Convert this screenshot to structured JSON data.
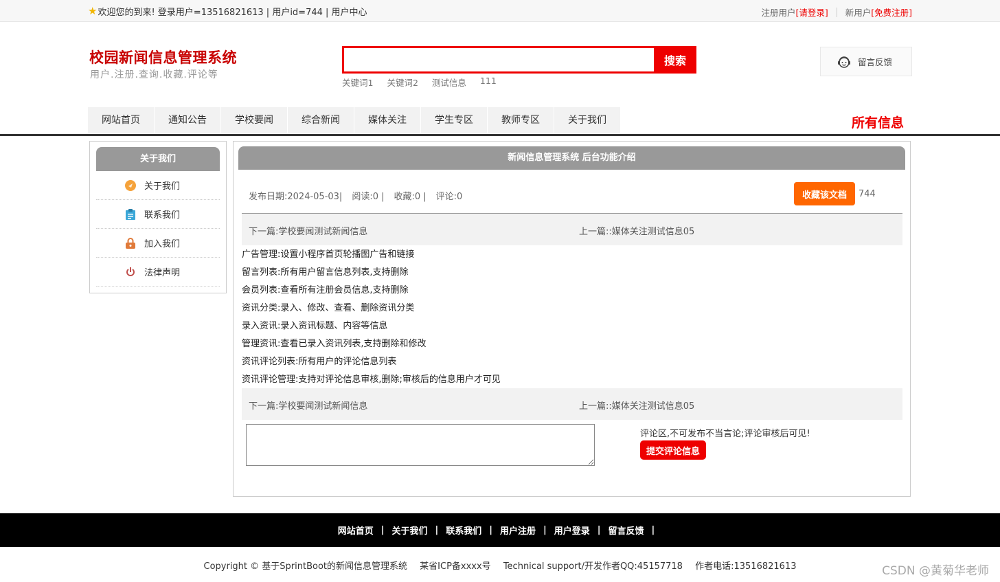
{
  "topbar": {
    "welcome": "欢迎您的到来!  登录用户=13516821613 | 用户id=744 | 用户中心",
    "reg_label": "注册用户",
    "login_link": "[请登录]",
    "new_label": "新用户",
    "register_link": "[免费注册]"
  },
  "header": {
    "title": "校园新闻信息管理系统",
    "subtitle": "用户.注册.查询.收藏.评论等",
    "search_button": "搜索",
    "keywords": [
      "关键词1",
      "关键词2",
      "测试信息",
      "111"
    ],
    "feedback": "留言反馈"
  },
  "nav": {
    "items": [
      "网站首页",
      "通知公告",
      "学校要闻",
      "综合新闻",
      "媒体关注",
      "学生专区",
      "教师专区",
      "关于我们"
    ],
    "all_info": "所有信息"
  },
  "sidebar": {
    "title": "关于我们",
    "items": [
      {
        "label": "关于我们",
        "icon": "orange-circle-icon"
      },
      {
        "label": "联系我们",
        "icon": "clipboard-icon"
      },
      {
        "label": "加入我们",
        "icon": "lock-icon"
      },
      {
        "label": "法律声明",
        "icon": "power-icon"
      }
    ]
  },
  "article": {
    "title": "新闻信息管理系统 后台功能介绍",
    "date": "发布日期:2024-05-03|",
    "reads": "阅读:0 |",
    "favorites": "收藏:0 |",
    "comments": "评论:0",
    "fav_button": "收藏该文档",
    "fav_count": "744",
    "next": "下一篇:学校要闻测试新闻信息",
    "prev": "上一篇::媒体关注测试信息05",
    "lines": [
      "广告管理:设置小程序首页轮播图广告和链接",
      "留言列表:所有用户留言信息列表,支持删除",
      "会员列表:查看所有注册会员信息,支持删除",
      "资讯分类:录入、修改、查看、删除资讯分类",
      "录入资讯:录入资讯标题、内容等信息",
      "管理资讯:查看已录入资讯列表,支持删除和修改",
      "资讯评论列表:所有用户的评论信息列表",
      "资讯评论管理:支持对评论信息审核,删除;审核后的信息用户才可见"
    ],
    "comment_tip": "评论区,不可发布不当言论;评论审核后可见!",
    "submit_button": "提交评论信息"
  },
  "footer": {
    "links": [
      "网站首页",
      "关于我们",
      "联系我们",
      "用户注册",
      "用户登录",
      "留言反馈"
    ],
    "copyright": "Copyright © 基于SprintBoot的新闻信息管理系统",
    "icp": "某省ICP备xxxx号",
    "support": "Technical support/开发作者QQ:45157718",
    "phone": "作者电话:13516821613",
    "watermark": "CSDN @黄菊华老师"
  }
}
